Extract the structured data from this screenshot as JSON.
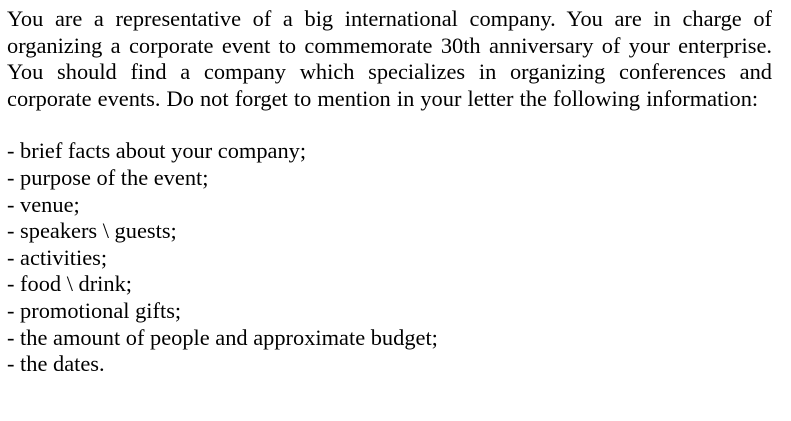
{
  "document": {
    "intro": "You are a representative of a big international company. You are in charge of organizing a corporate event to commemorate 30th anniversary of your enterprise. You should find a company which specializes in organizing conferences and corporate events. Do not forget to mention in your letter the following information:",
    "items": [
      "- brief facts about your company;",
      "- purpose of the event;",
      "- venue;",
      "- speakers \\ guests;",
      "- activities;",
      "- food \\ drink;",
      "- promotional gifts;",
      "- the amount of people and approximate budget;",
      "- the dates."
    ]
  }
}
